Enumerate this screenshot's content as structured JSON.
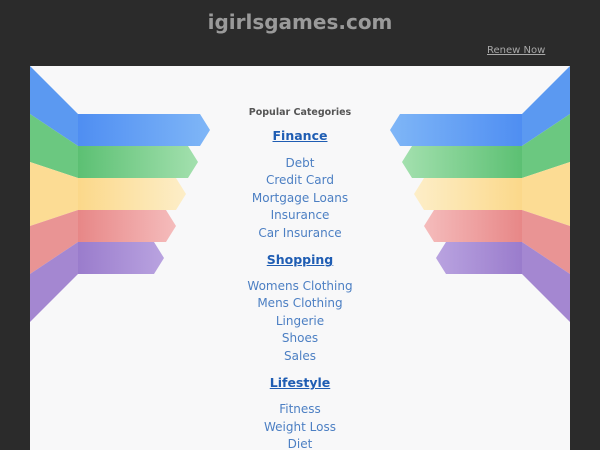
{
  "header": {
    "domain": "igirlsgames.com",
    "renew_label": "Renew Now"
  },
  "main": {
    "popular_label": "Popular Categories",
    "categories": [
      {
        "title": "Finance",
        "items": [
          "Debt",
          "Credit Card",
          "Mortgage Loans",
          "Insurance",
          "Car Insurance"
        ]
      },
      {
        "title": "Shopping",
        "items": [
          "Womens Clothing",
          "Mens Clothing",
          "Lingerie",
          "Shoes",
          "Sales"
        ]
      },
      {
        "title": "Lifestyle",
        "items": [
          "Fitness",
          "Weight Loss",
          "Diet"
        ]
      }
    ]
  },
  "colors": {
    "stripe_blue": "#6aa7f5",
    "stripe_green": "#7fd08f",
    "stripe_yellow": "#fde3a7",
    "stripe_red": "#ee9d9d",
    "stripe_purple": "#a58bd3"
  }
}
